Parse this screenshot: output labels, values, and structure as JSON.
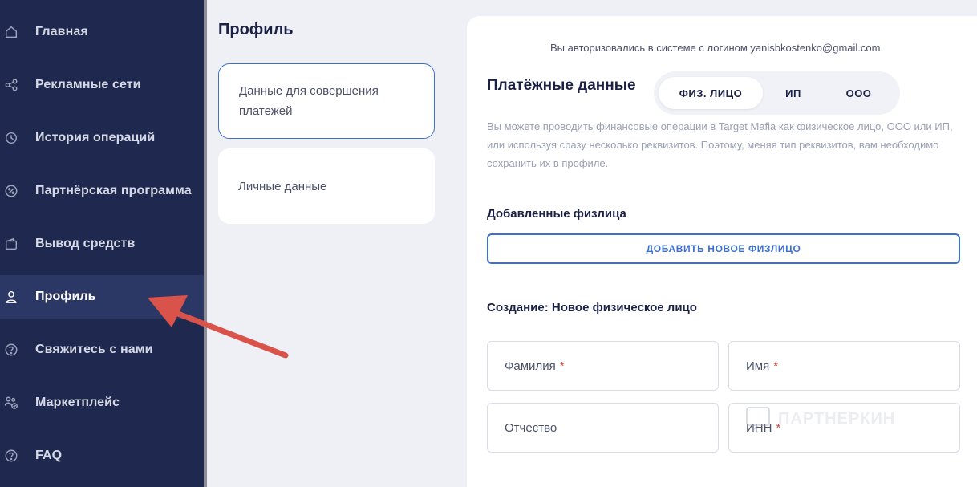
{
  "sidebar": {
    "items": [
      {
        "label": "Главная",
        "icon": "home-icon"
      },
      {
        "label": "Рекламные сети",
        "icon": "share-network-icon"
      },
      {
        "label": "История операций",
        "icon": "history-clock-icon"
      },
      {
        "label": "Партнёрская программа",
        "icon": "percent-icon"
      },
      {
        "label": "Вывод средств",
        "icon": "wallet-icon"
      },
      {
        "label": "Профиль",
        "icon": "user-icon"
      },
      {
        "label": "Свяжитесь с нами",
        "icon": "question-icon"
      },
      {
        "label": "Маркетплейс",
        "icon": "users-check-icon"
      },
      {
        "label": "FAQ",
        "icon": "faq-question-icon"
      }
    ],
    "active": "Профиль"
  },
  "profile": {
    "title": "Профиль",
    "cards": [
      {
        "label": "Данные для совершения платежей"
      },
      {
        "label": "Личные данные"
      }
    ]
  },
  "payment": {
    "login_note": "Вы авторизовались в системе с логином yanisbkostenko@gmail.com",
    "title": "Платёжные данные",
    "types": [
      "ФИЗ. ЛИЦО",
      "ИП",
      "ООО"
    ],
    "active_type": "ФИЗ. ЛИЦО",
    "info": "Вы можете проводить финансовые операции в Target Mafia как физическое лицо, ООО или ИП, или используя сразу несколько реквизитов. Поэтому, меняя тип реквизитов, вам необходимо сохранить их в профиле.",
    "added_title": "Добавленные физлица",
    "add_button": "ДОБАВИТЬ НОВОЕ ФИЗЛИЦО",
    "create_title": "Создание: Новое физическое лицо",
    "fields": {
      "last_name": "Фамилия",
      "first_name": "Имя",
      "patronymic": "Отчество",
      "inn": "ИНН",
      "required_mark": "*"
    }
  },
  "watermark": "ПАРТНЕРКИН",
  "colors": {
    "sidebar_bg": "#1f2950",
    "sidebar_active": "#2b3866",
    "accent": "#3b6fd0",
    "required": "#e0443a",
    "arrow": "#d9534a"
  }
}
